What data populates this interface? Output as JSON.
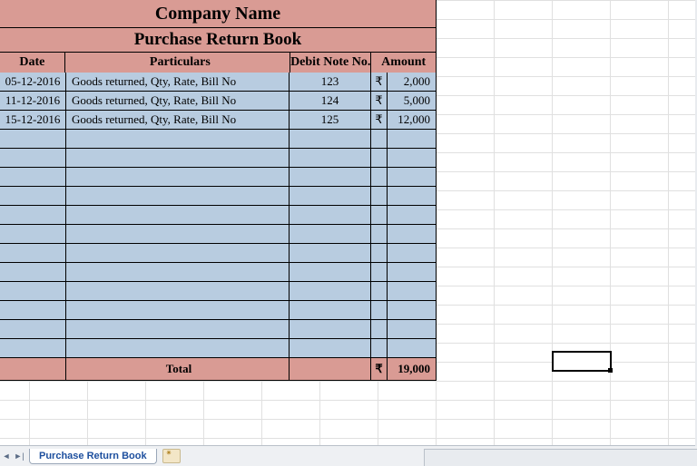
{
  "header": {
    "company": "Company Name",
    "title": "Purchase Return Book"
  },
  "columns": {
    "date": "Date",
    "particulars": "Particulars",
    "debit_note": "Debit Note No.",
    "amount": "Amount"
  },
  "currency_symbol": "₹",
  "rows": [
    {
      "date": "05-12-2016",
      "particulars": "Goods returned, Qty, Rate, Bill No",
      "debit_note": "123",
      "amount": "2,000"
    },
    {
      "date": "11-12-2016",
      "particulars": "Goods returned, Qty, Rate, Bill No",
      "debit_note": "124",
      "amount": "5,000"
    },
    {
      "date": "15-12-2016",
      "particulars": "Goods returned, Qty, Rate, Bill No",
      "debit_note": "125",
      "amount": "12,000"
    }
  ],
  "empty_rows": 12,
  "total": {
    "label": "Total",
    "amount": "19,000"
  },
  "tabs": {
    "active": "Purchase Return Book"
  },
  "colors": {
    "header_bg": "#d99b94",
    "body_bg": "#b8cce0"
  }
}
